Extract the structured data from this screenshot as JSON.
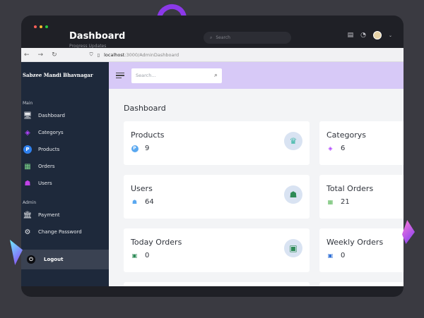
{
  "window": {
    "title": "Dashboard",
    "subtitle": "Progress Updates",
    "search_placeholder": "Search"
  },
  "browser": {
    "url_host": "localhost",
    "url_path": ":3000/AdminDashboard"
  },
  "sidebar": {
    "brand": "Sabzee Mandi Bhavnagar",
    "section_main": "Main",
    "section_admin": "Admin",
    "main_items": [
      {
        "label": "Dashboard",
        "icon": "monitor-icon"
      },
      {
        "label": "Categorys",
        "icon": "cubes-icon"
      },
      {
        "label": "Products",
        "icon": "product-p-icon"
      },
      {
        "label": "Orders",
        "icon": "orders-icon"
      },
      {
        "label": "Users",
        "icon": "users-icon"
      }
    ],
    "admin_items": [
      {
        "label": "Payment",
        "icon": "bank-icon"
      },
      {
        "label": "Change Password",
        "icon": "gear-icon"
      }
    ],
    "logout": "Logout"
  },
  "topbar": {
    "search_placeholder": "Search..."
  },
  "main": {
    "heading": "Dashboard",
    "cards": [
      {
        "label": "Products",
        "value": "9",
        "icon": "crown-icon"
      },
      {
        "label": "Categorys",
        "value": "6",
        "icon": "cubes-icon"
      },
      {
        "label": "Users",
        "value": "64",
        "icon": "users-icon"
      },
      {
        "label": "Total Orders",
        "value": "21",
        "icon": "orders-icon"
      },
      {
        "label": "Today Orders",
        "value": "0",
        "icon": "calendar-icon"
      },
      {
        "label": "Weekly Orders",
        "value": "0",
        "icon": "calendar-icon"
      }
    ]
  },
  "colors": {
    "sidebar_bg": "#1e293b",
    "topbar_bg": "#d7c9f7",
    "accent_green": "#2e8b57",
    "accent_purple": "#8b39e8"
  }
}
